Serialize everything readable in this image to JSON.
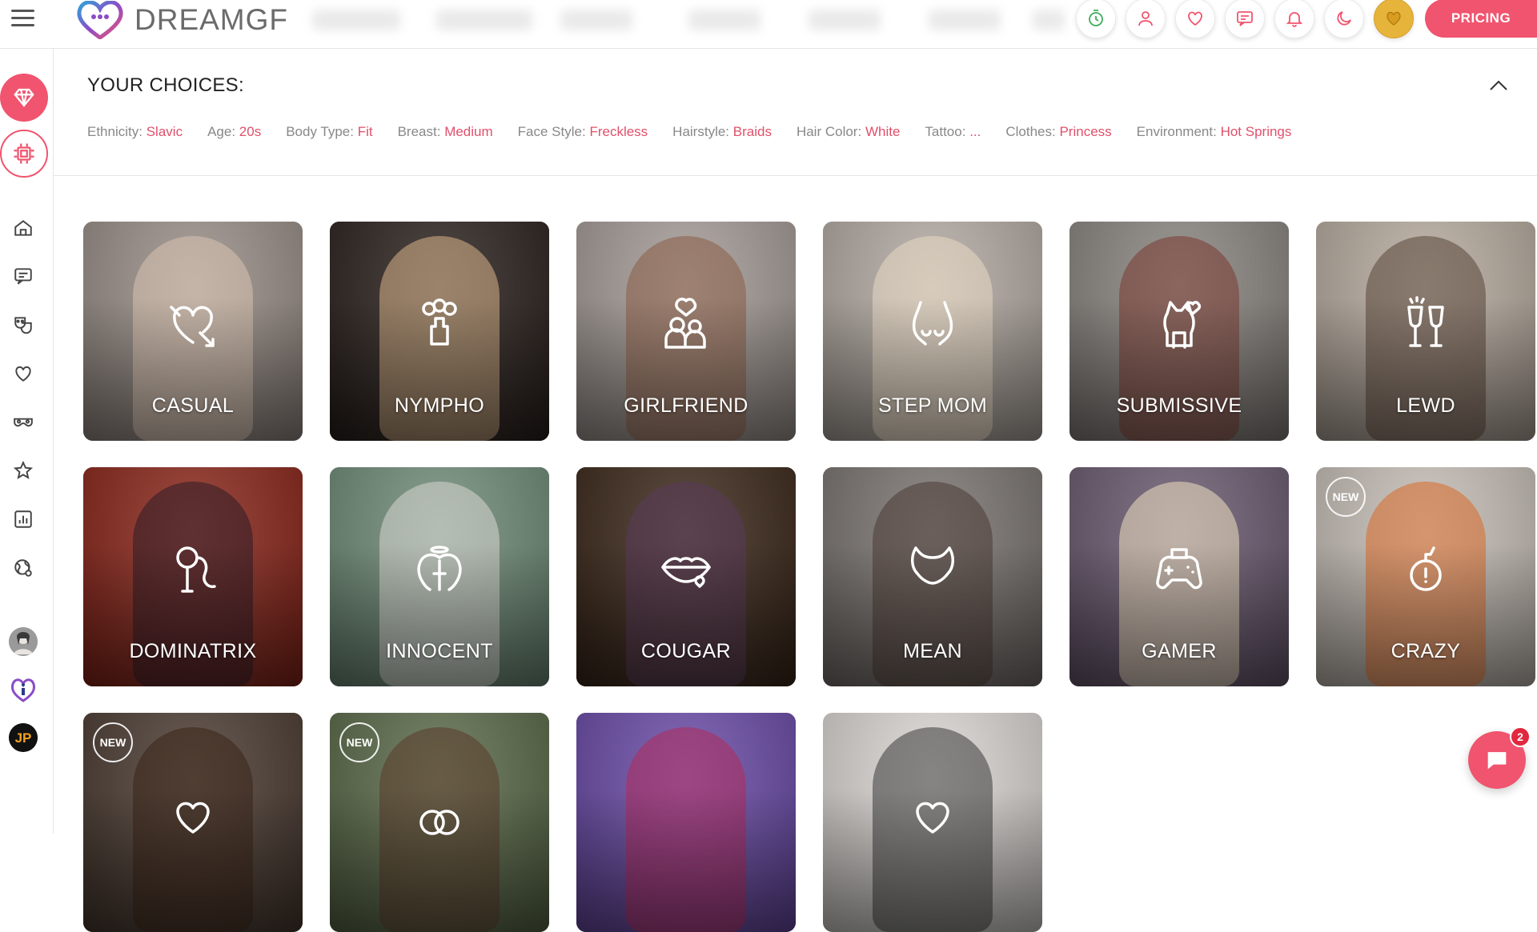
{
  "brand": {
    "name": "DREAMGF",
    "accent": "#f0546e"
  },
  "header": {
    "pricing_label": "PRICING",
    "icons": [
      "timer-icon",
      "user-icon",
      "heart-icon",
      "chat-icon",
      "bell-icon",
      "moon-icon",
      "gold-heart-icon"
    ]
  },
  "choices": {
    "title": "YOUR CHOICES:",
    "items": [
      {
        "key": "Ethnicity:",
        "value": "Slavic"
      },
      {
        "key": "Age:",
        "value": "20s"
      },
      {
        "key": "Body Type:",
        "value": "Fit"
      },
      {
        "key": "Breast:",
        "value": "Medium"
      },
      {
        "key": "Face Style:",
        "value": "Freckless"
      },
      {
        "key": "Hairstyle:",
        "value": "Braids"
      },
      {
        "key": "Hair Color:",
        "value": "White"
      },
      {
        "key": "Tattoo:",
        "value": "..."
      },
      {
        "key": "Clothes:",
        "value": "Princess"
      },
      {
        "key": "Environment:",
        "value": "Hot Springs"
      }
    ]
  },
  "sidebar": {
    "items": [
      "diamond-icon",
      "chip-icon",
      "home-icon",
      "chat-icon",
      "masks-icon",
      "heart-icon",
      "mask-icon",
      "star-icon",
      "chart-icon",
      "globe-icon",
      "avatar-icon",
      "info-heart-icon",
      "jp-icon"
    ]
  },
  "cards": [
    {
      "label": "CASUAL",
      "new": false,
      "bg": "#9a8f88",
      "fig": "#d8c3b0",
      "glyph": "heart-arrow"
    },
    {
      "label": "NYMPHO",
      "new": false,
      "bg": "#2a201c",
      "fig": "#d8b48a",
      "glyph": "flame"
    },
    {
      "label": "GIRLFRIEND",
      "new": false,
      "bg": "#a59c97",
      "fig": "#8a5c45",
      "glyph": "couple"
    },
    {
      "label": "STEP MOM",
      "new": false,
      "bg": "#b5aca4",
      "fig": "#e8d9c2",
      "glyph": "body"
    },
    {
      "label": "SUBMISSIVE",
      "new": false,
      "bg": "#8a8580",
      "fig": "#7a3b31",
      "glyph": "cat"
    },
    {
      "label": "LEWD",
      "new": false,
      "bg": "#b8aca0",
      "fig": "#5a4538",
      "glyph": "glasses"
    },
    {
      "label": "DOMINATRIX",
      "new": false,
      "bg": "#8a2418",
      "fig": "#2c1c26",
      "glyph": "whip"
    },
    {
      "label": "INNOCENT",
      "new": false,
      "bg": "#6f8c78",
      "fig": "#d8d6d2",
      "glyph": "angel"
    },
    {
      "label": "COUGAR",
      "new": false,
      "bg": "#3a2618",
      "fig": "#5a3a5a",
      "glyph": "lips"
    },
    {
      "label": "MEAN",
      "new": false,
      "bg": "#7a7470",
      "fig": "#4a3a34",
      "glyph": "horns"
    },
    {
      "label": "GAMER",
      "new": false,
      "bg": "#6a5a70",
      "fig": "#efe0c0",
      "glyph": "gamepad"
    },
    {
      "label": "CRAZY",
      "new": true,
      "bg": "#c8c0b8",
      "fig": "#d86a28",
      "glyph": "bomb"
    },
    {
      "label": "",
      "new": true,
      "bg": "#4a3a30",
      "fig": "#3a2418",
      "glyph": "heart-small"
    },
    {
      "label": "",
      "new": true,
      "bg": "#5a6a48",
      "fig": "#5a3a2a",
      "glyph": "rings"
    },
    {
      "label": "",
      "new": false,
      "bg": "#6a4aa8",
      "fig": "#b02a5a",
      "glyph": "none"
    },
    {
      "label": "",
      "new": false,
      "bg": "#dcd8d4",
      "fig": "#3a3a3a",
      "glyph": "heart-small"
    }
  ],
  "new_badge_text": "NEW",
  "chat": {
    "count": "2"
  }
}
